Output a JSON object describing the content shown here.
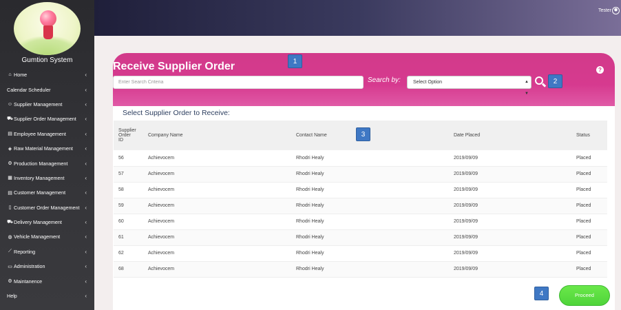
{
  "sidebar": {
    "brand": "Gumtion System",
    "items": [
      {
        "label": "Home",
        "icon": "home-icon",
        "glyph": "⌂"
      },
      {
        "label": "Calendar Scheduler",
        "icon": "",
        "glyph": ""
      },
      {
        "label": "Supplier Management",
        "icon": "users-icon",
        "glyph": "☺"
      },
      {
        "label": "Supplier Order Management",
        "icon": "cart-icon",
        "glyph": "⛟"
      },
      {
        "label": "Employee Management",
        "icon": "id-card-icon",
        "glyph": "▤"
      },
      {
        "label": "Raw Material Management",
        "icon": "tags-icon",
        "glyph": "◈"
      },
      {
        "label": "Production Management",
        "icon": "cogs-icon",
        "glyph": "⚙"
      },
      {
        "label": "Inventory Management",
        "icon": "th-icon",
        "glyph": "▦"
      },
      {
        "label": "Customer Management",
        "icon": "address-card-icon",
        "glyph": "▤"
      },
      {
        "label": "Customer Order Management",
        "icon": "file-icon",
        "glyph": "▯"
      },
      {
        "label": "Delivery Management",
        "icon": "truck-icon",
        "glyph": "⛟"
      },
      {
        "label": "Vehicle Management",
        "icon": "car-icon",
        "glyph": "◍"
      },
      {
        "label": "Reporting",
        "icon": "line-chart-icon",
        "glyph": "⟋"
      },
      {
        "label": "Administration",
        "icon": "laptop-icon",
        "glyph": "▭"
      },
      {
        "label": "Maintanence",
        "icon": "gear-icon",
        "glyph": "⚙"
      },
      {
        "label": "Help",
        "icon": "",
        "glyph": ""
      }
    ]
  },
  "header": {
    "user": "Tester"
  },
  "page": {
    "title": "Receive Supplier Order",
    "search_placeholder": "Enter Search Criteria",
    "search_by_label": "Search by:",
    "select_value": "Select Option",
    "section_title": "Select Supplier Order to Receive:",
    "proceed_label": "Proceed"
  },
  "markers": [
    "1",
    "2",
    "3",
    "4"
  ],
  "table": {
    "headers": [
      "Supplier\nOrder\nID",
      "Company Name",
      "Contact Name",
      "Date Placed",
      "Status"
    ],
    "rows": [
      [
        "56",
        "Achievocem",
        "Rhodri Healy",
        "2019/09/09",
        "Placed"
      ],
      [
        "57",
        "Achievocem",
        "Rhodri Healy",
        "2019/09/09",
        "Placed"
      ],
      [
        "58",
        "Achievocem",
        "Rhodri Healy",
        "2019/09/09",
        "Placed"
      ],
      [
        "59",
        "Achievocem",
        "Rhodri Healy",
        "2019/09/09",
        "Placed"
      ],
      [
        "60",
        "Achievocem",
        "Rhodri Healy",
        "2019/09/09",
        "Placed"
      ],
      [
        "61",
        "Achievocem",
        "Rhodri Healy",
        "2019/09/09",
        "Placed"
      ],
      [
        "62",
        "Achievocem",
        "Rhodri Healy",
        "2019/09/09",
        "Placed"
      ],
      [
        "68",
        "Achievocem",
        "Rhodri Healy",
        "2019/09/09",
        "Placed"
      ]
    ]
  },
  "colors": {
    "banner": "#d23a8a",
    "proceed": "#55d83e",
    "marker": "#3f78c4",
    "sidebar": "#2f2f33"
  }
}
